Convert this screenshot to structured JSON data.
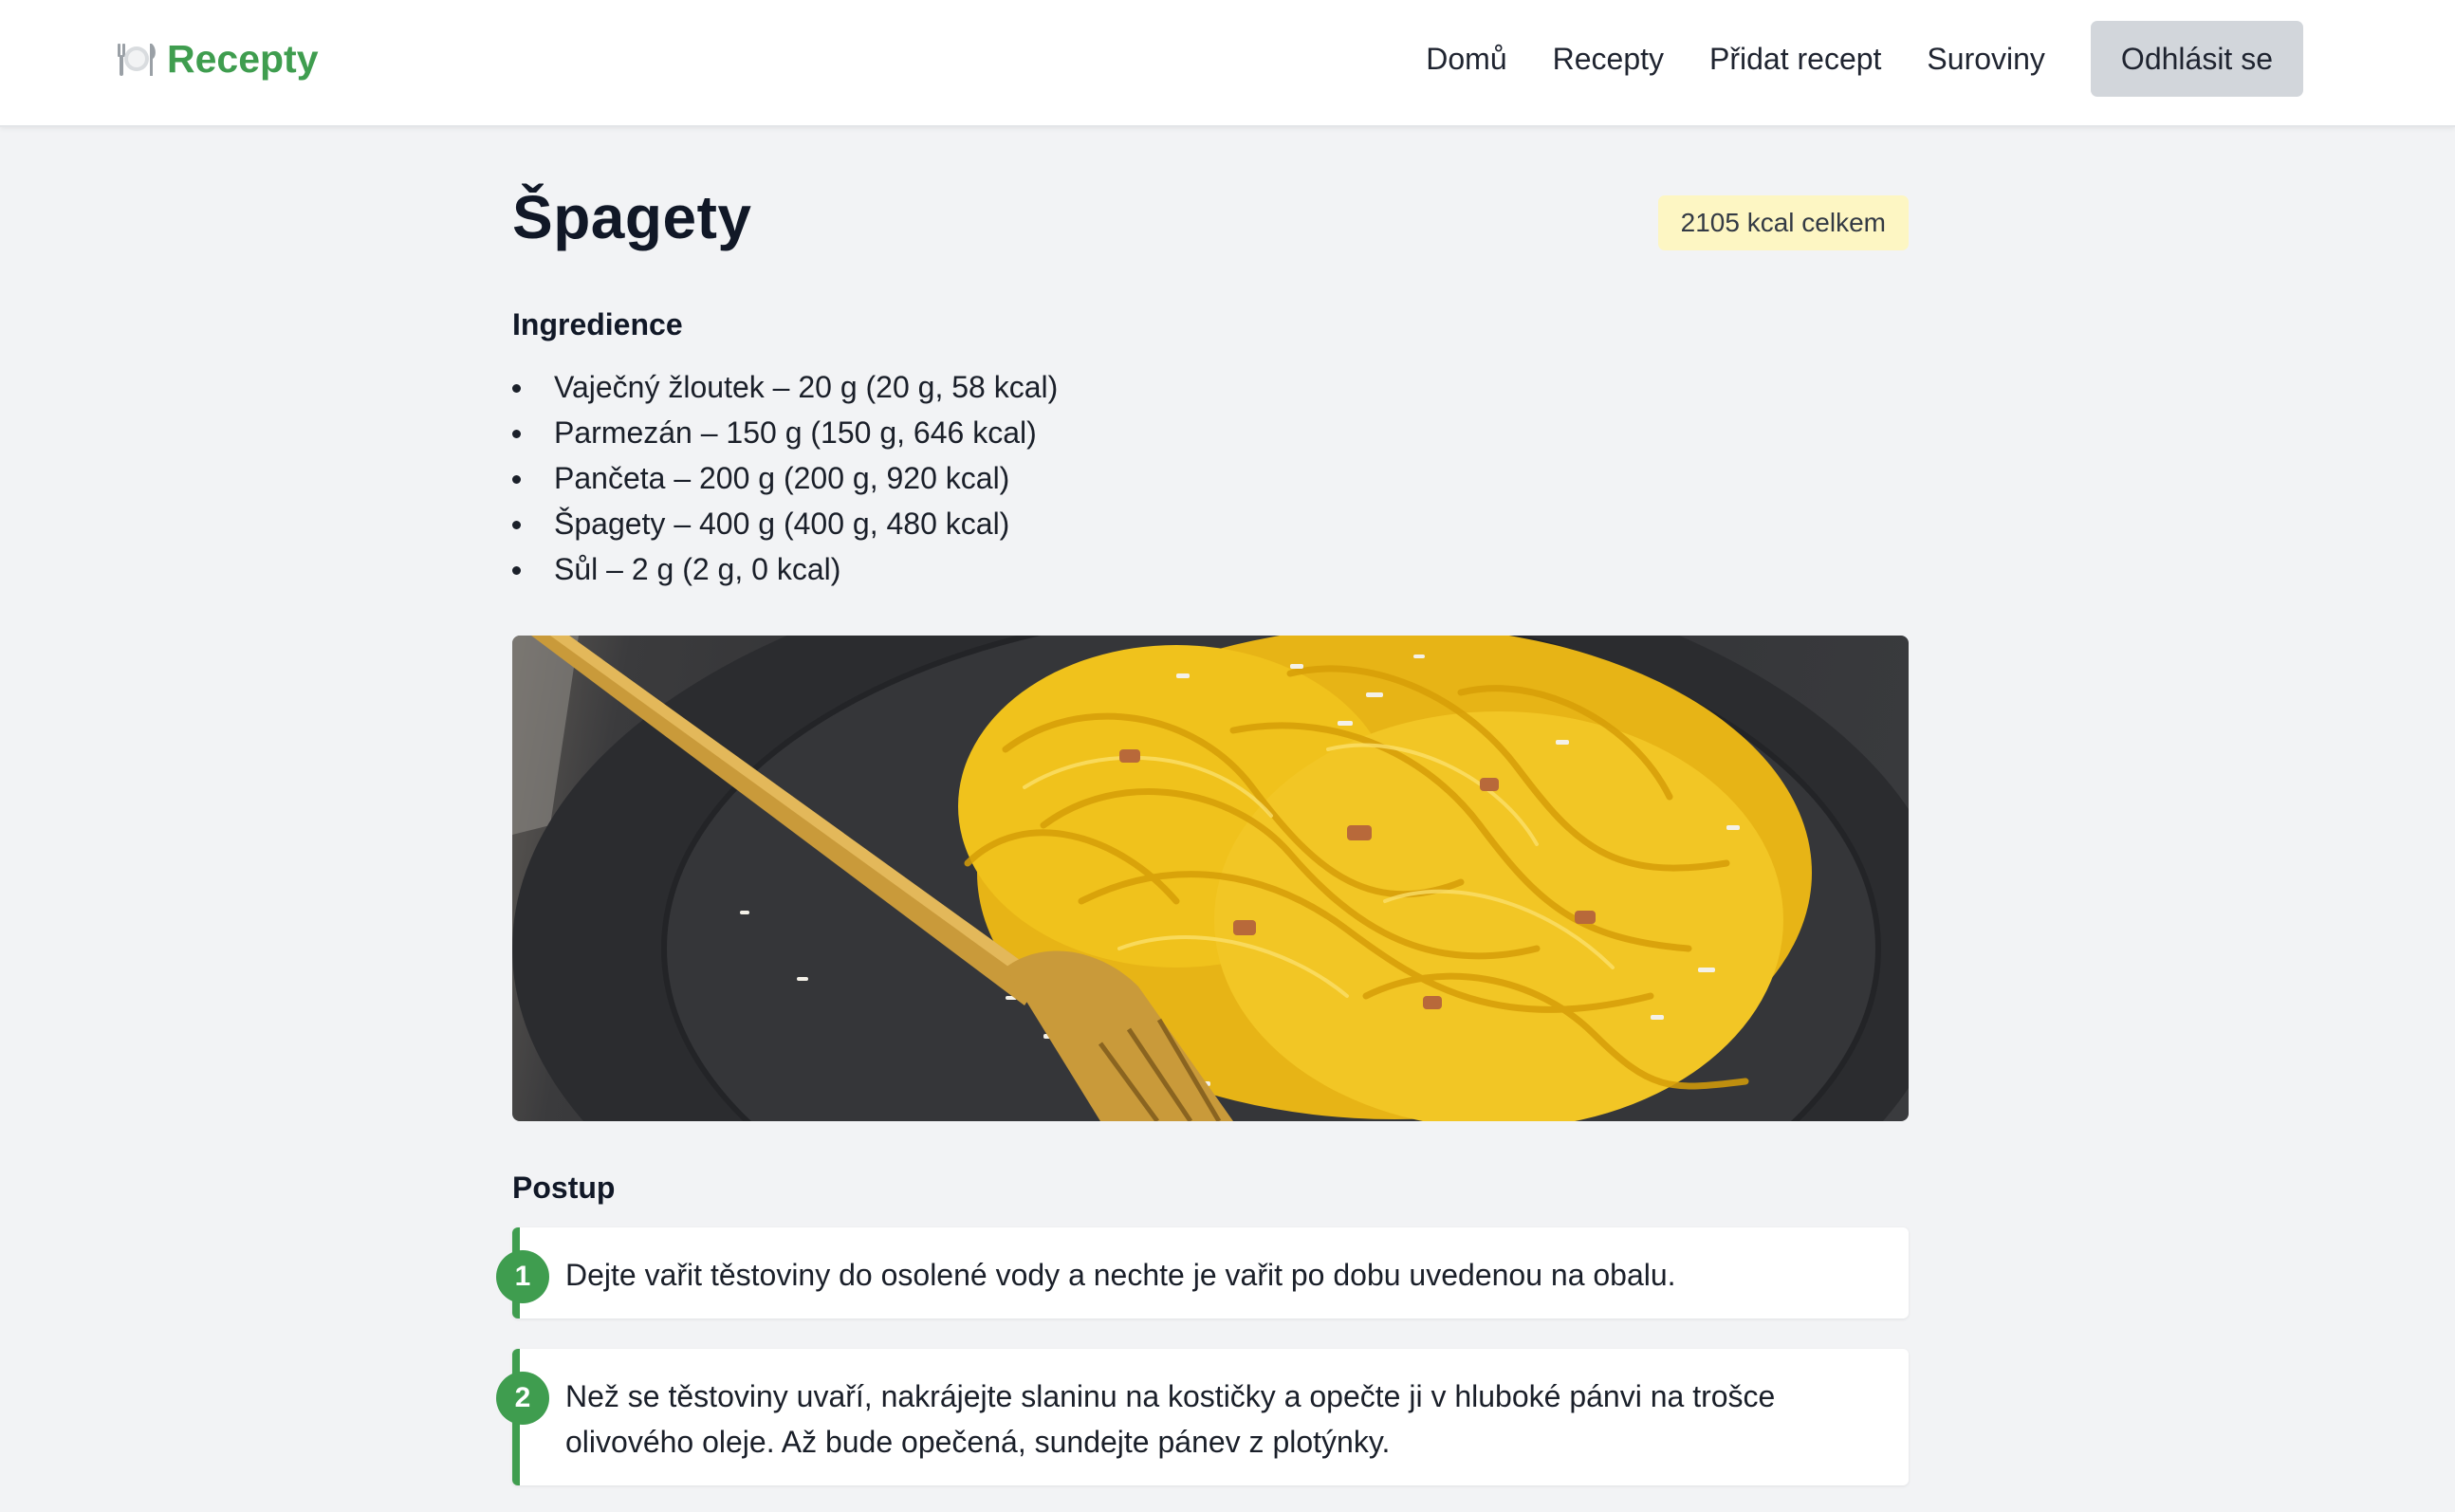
{
  "header": {
    "brand_icon": "plate-utensils-icon",
    "brand_label": "Recepty",
    "brand_color": "#3f9d4f",
    "nav": [
      {
        "label": "Domů"
      },
      {
        "label": "Recepty"
      },
      {
        "label": "Přidat recept"
      },
      {
        "label": "Suroviny"
      }
    ],
    "logout_label": "Odhlásit se"
  },
  "recipe": {
    "title": "Špagety",
    "kcal_badge": "2105 kcal celkem",
    "ingredients_heading": "Ingredience",
    "ingredients": [
      "Vaječný žloutek – 20 g (20 g, 58 kcal)",
      "Parmezán – 150 g (150 g, 646 kcal)",
      "Pančeta – 200 g (200 g, 920 kcal)",
      "Špagety – 400 g (400 g, 480 kcal)",
      "Sůl – 2 g (2 g, 0 kcal)"
    ],
    "image": "spaghetti-carbonara-photo",
    "steps_heading": "Postup",
    "steps": [
      {
        "number": "1",
        "text": "Dejte vařit těstoviny do osolené vody a nechte je vařit po dobu uvedenou na obalu."
      },
      {
        "number": "2",
        "text": "Než se těstoviny uvaří, nakrájejte slaninu na kostičky a opečte ji v hluboké pánvi na trošce olivového oleje. Až bude opečená, sundejte pánev z plotýnky."
      }
    ]
  }
}
